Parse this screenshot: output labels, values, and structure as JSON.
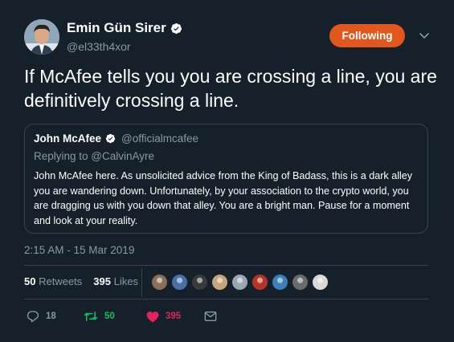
{
  "author": {
    "name": "Emin Gün Sirer",
    "handle": "@el33th4xor",
    "verified": true
  },
  "follow_button": {
    "label": "Following",
    "color": "#e0581f"
  },
  "tweet": {
    "text": "If McAfee tells you you are crossing a line, you are definitively crossing a line."
  },
  "quoted_tweet": {
    "name": "John McAfee",
    "handle": "@officialmcafee",
    "verified": true,
    "reply_to": "Replying to @CalvinAyre",
    "text": "John McAfee here. As unsolicited advice from the King of Badass, this is a dark alley you are wandering down. Unfortunately, by your association to the crypto world, you are dragging us with you down that alley. You are a bright man. Pause for a moment and look at your reality."
  },
  "timestamp": "2:15 AM - 15 Mar 2019",
  "stats": {
    "retweets_count": "50",
    "retweets_label": "Retweets",
    "likes_count": "395",
    "likes_label": "Likes"
  },
  "liker_avatars": [
    {
      "name": "liker-avatar-1",
      "color": "#8a6e5a"
    },
    {
      "name": "liker-avatar-2",
      "color": "#4a6fa5"
    },
    {
      "name": "liker-avatar-3",
      "color": "#3a3a3a"
    },
    {
      "name": "liker-avatar-4",
      "color": "#c9a27e"
    },
    {
      "name": "liker-avatar-5",
      "color": "#9aa7b3"
    },
    {
      "name": "liker-avatar-6",
      "color": "#b5342a"
    },
    {
      "name": "liker-avatar-7",
      "color": "#3d7fb8"
    },
    {
      "name": "liker-avatar-8",
      "color": "#6b6b6b"
    },
    {
      "name": "liker-avatar-9",
      "color": "#d8d8d8"
    }
  ],
  "actions": {
    "reply_count": "18",
    "retweet_count": "50",
    "like_count": "395",
    "reply_color": "#8899a6",
    "retweet_color": "#17bf63",
    "like_color": "#e0245e"
  },
  "colors": {
    "background": "#15202b",
    "secondary_text": "#8899a6",
    "border": "#38444d"
  }
}
